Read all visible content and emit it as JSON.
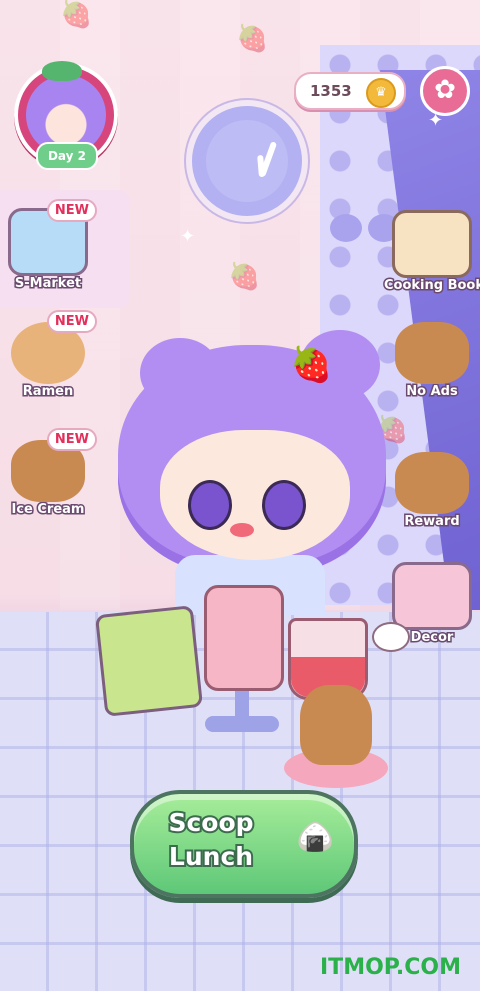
{
  "hud": {
    "day_label": "Day 2",
    "coins": "1353",
    "icons": {
      "coin": "crown-coin-icon",
      "settings": "gear-icon"
    }
  },
  "left_menu": [
    {
      "id": "s-market",
      "label": "S-Market",
      "badge": "NEW",
      "icon": "supermarket-icon"
    },
    {
      "id": "ramen",
      "label": "Ramen",
      "badge": "NEW",
      "icon": "ramen-bowl-icon"
    },
    {
      "id": "ice-cream",
      "label": "Ice Cream",
      "badge": "NEW",
      "icon": "ice-cream-sundae-icon"
    }
  ],
  "right_menu": [
    {
      "id": "cooking-book",
      "label": "Cooking Book",
      "icon": "recipe-book-icon"
    },
    {
      "id": "no-ads",
      "label": "No Ads",
      "icon": "no-ads-capybara-icon"
    },
    {
      "id": "reward",
      "label": "Reward",
      "icon": "reward-scroll-icon"
    },
    {
      "id": "decor",
      "label": "Decor",
      "icon": "decor-dresser-icon"
    }
  ],
  "action": {
    "line1": "Scoop",
    "line2": "Lunch"
  },
  "watermark": "ITMOP.COM",
  "colors": {
    "accent_pink": "#e96c96",
    "button_green": "#5ec878",
    "badge_red": "#e2305c",
    "wall": "#f9e3ea",
    "floor": "#dfe0f8"
  }
}
